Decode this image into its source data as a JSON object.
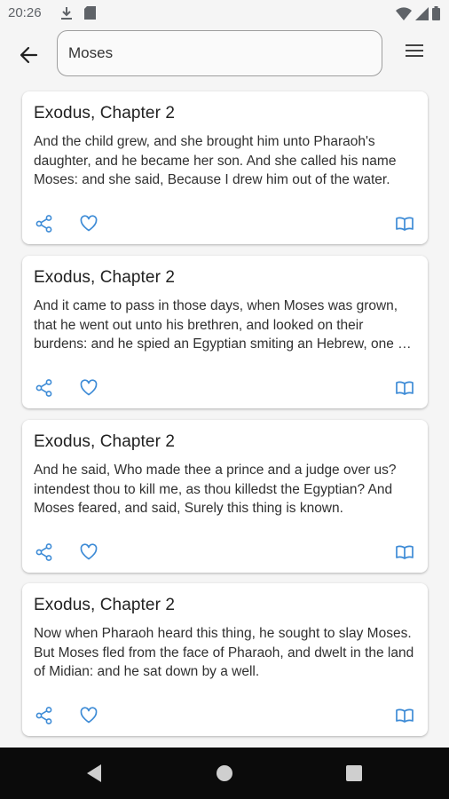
{
  "status": {
    "time": "20:26"
  },
  "search": {
    "value": "Moses"
  },
  "results": [
    {
      "title": "Exodus, Chapter 2",
      "text": "And the child grew, and she brought him unto Pharaoh's daughter, and he became her son. And she called his name Moses: and she said, Because I drew him out of the water."
    },
    {
      "title": "Exodus, Chapter 2",
      "text": "And it came to pass in those days, when Moses was grown, that he went out unto his brethren, and looked on their burdens: and he spied an Egyptian smiting an Hebrew, one of his brethren."
    },
    {
      "title": "Exodus, Chapter 2",
      "text": "And he said, Who made thee a prince and a judge over us? intendest thou to kill me, as thou killedst the Egyptian? And Moses feared, and said, Surely this thing is known."
    },
    {
      "title": "Exodus, Chapter 2",
      "text": "Now when Pharaoh heard this thing, he sought to slay Moses. But Moses fled from the face of Pharaoh, and dwelt in the land of Midian: and he sat down by a well."
    }
  ],
  "icons": {
    "share": "share-icon",
    "favorite": "heart-icon",
    "read": "open-book-icon"
  },
  "colors": {
    "accent": "#3d8bd6",
    "nav_bar": "#0b0b0b"
  }
}
